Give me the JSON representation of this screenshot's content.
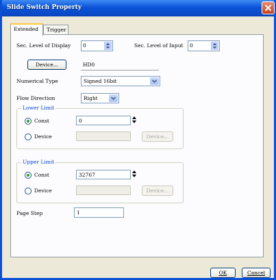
{
  "window": {
    "title": "Slide Switch Property"
  },
  "tabs": [
    {
      "label": "Extended",
      "active": true
    },
    {
      "label": "Trigger",
      "active": false
    }
  ],
  "extended": {
    "sec_level_display_label": "Sec. Level of Display",
    "sec_level_display_value": "0",
    "sec_level_input_label": "Sec. Level of Input",
    "sec_level_input_value": "0",
    "device_button": "Device...",
    "device_value": "HD0",
    "numerical_type_label": "Numerical Type",
    "numerical_type_value": "Signed 16bit",
    "flow_direction_label": "Flow Direction",
    "flow_direction_value": "Right",
    "lower_limit": {
      "title": "Lower Limit",
      "const_label": "Const",
      "const_value": "0",
      "const_selected": true,
      "device_label": "Device",
      "device_button": "Device...",
      "device_value": ""
    },
    "upper_limit": {
      "title": "Upper Limit",
      "const_label": "Const",
      "const_value": "32767",
      "const_selected": true,
      "device_label": "Device",
      "device_button": "Device...",
      "device_value": ""
    },
    "page_step_label": "Page Step",
    "page_step_value": "1"
  },
  "footer": {
    "ok": "OK",
    "cancel": "Cancel"
  },
  "colors": {
    "title_bar": "#0a53d8",
    "close_button": "#c6401f",
    "group_title": "#0046d5",
    "dialog_bg": "#ece9d8"
  },
  "icons": {
    "close": "close-icon",
    "spin": "spin-arrows-icon",
    "dropdown": "chevron-down-icon",
    "stepper": "stepper-icon"
  }
}
